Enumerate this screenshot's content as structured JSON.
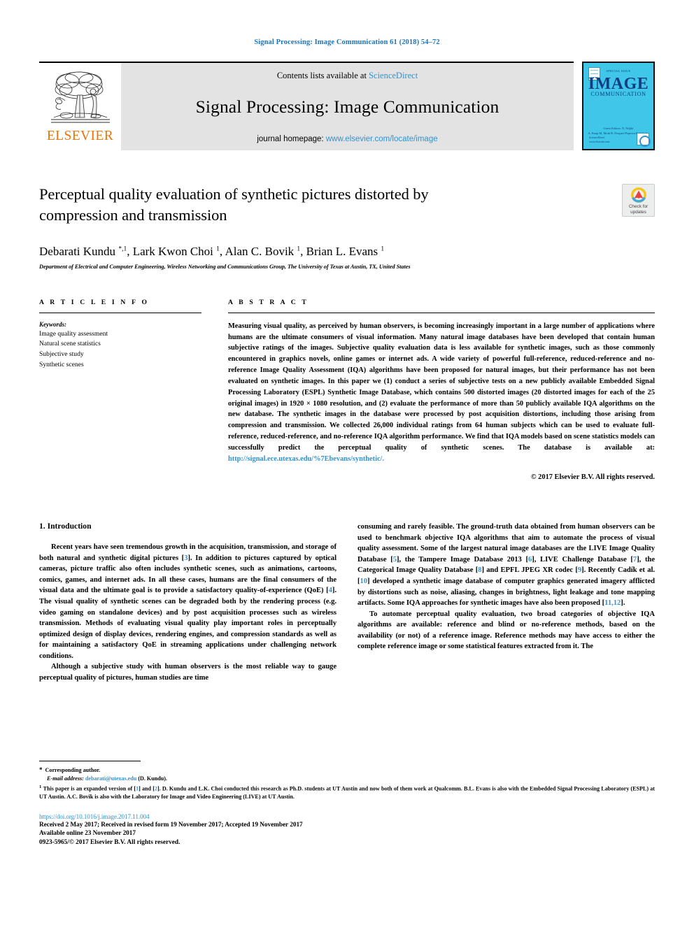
{
  "running_head": "Signal Processing: Image Communication 61 (2018) 54–72",
  "masthead": {
    "publisher_name": "ELSEVIER",
    "contents_prefix": "Contents lists available at",
    "contents_link": "ScienceDirect",
    "journal_name": "Signal Processing: Image Communication",
    "homepage_prefix": "journal homepage:",
    "homepage_link": "www.elsevier.com/locate/image",
    "cover": {
      "superline": "SPECIAL ISSUE",
      "title_line1": "IMAGE",
      "title_line2": "COMMUNICATION",
      "footer_line1": "Guest Editors: N. Ndjiki",
      "footer_line2": "A. Kaup  M. Mrak  B. Pesquet-Popescu  R. Schafer",
      "url_line1": "ScienceDirect",
      "url_line2": "www.elsevier.com"
    }
  },
  "article": {
    "title": "Perceptual quality evaluation of synthetic pictures distorted by compression and transmission",
    "authors_html": "Debarati Kundu <sup>*,1</sup>, Lark Kwon Choi <sup>1</sup>, Alan C. Bovik <sup>1</sup>, Brian L. Evans <sup>1</sup>",
    "affiliation": "Department of Electrical and Computer Engineering, Wireless Networking and Communications Group, The University of Texas at Austin, TX, United States",
    "crossmark_label_line1": "Check for",
    "crossmark_label_line2": "updates"
  },
  "article_info": {
    "heading": "A R T I C L E    I N F O",
    "keywords_label": "Keywords:",
    "keywords": [
      "Image quality assessment",
      "Natural scene statistics",
      "Subjective study",
      "Synthetic scenes"
    ]
  },
  "abstract": {
    "heading": "A B S T R A C T",
    "text_part1": "Measuring visual quality, as perceived by human observers, is becoming increasingly important in a large number of applications where humans are the ultimate consumers of visual information. Many natural image databases have been developed that contain human subjective ratings of the images. Subjective quality evaluation data is less available for synthetic images, such as those commonly encountered in graphics novels, online games or internet ads. A wide variety of powerful full-reference, reduced-reference and no-reference Image Quality Assessment (IQA) algorithms have been proposed for natural images, but their performance has not been evaluated on synthetic images. In this paper we (1) conduct a series of subjective tests on a new publicly available Embedded Signal Processing Laboratory (ESPL) Synthetic Image Database, which contains 500 distorted images (20 distorted images for each of the 25 original images) in 1920 × 1080 resolution, and (2) evaluate the performance of more than 50 publicly available IQA algorithms on the new database. The synthetic images in the database were processed by post acquisition distortions, including those arising from compression and transmission. We collected 26,000 individual ratings from 64 human subjects which can be used to evaluate full-reference, reduced-reference, and no-reference IQA algorithm performance. We find that IQA models based on scene statistics models can successfully predict the perceptual quality of synthetic scenes. The database is available at: ",
    "database_url": "http://signal.ece.utexas.edu/%7Ebevans/synthetic/.",
    "copyright": "© 2017 Elsevier B.V. All rights reserved."
  },
  "body": {
    "section_heading": "1.  Introduction",
    "left_paragraph_1_a": "Recent years have seen tremendous growth in the acquisition, transmission, and storage of both natural and synthetic digital pictures [",
    "left_paragraph_1_ref": "3",
    "left_paragraph_1_b": "]. In addition to pictures captured by optical cameras, picture traffic also often includes synthetic scenes, such as animations, cartoons, comics, games, and internet ads. In all these cases, humans are the final consumers of the visual data and the ultimate goal is to provide a satisfactory quality-of-experience (QoE) [",
    "left_paragraph_1_ref2": "4",
    "left_paragraph_1_c": "]. The visual quality of synthetic scenes can be degraded both by the rendering process (e.g. video gaming on standalone devices) and by post acquisition processes such as wireless transmission. Methods of evaluating visual quality play important roles in perceptually optimized design of display devices, rendering engines, and compression standards as well as for maintaining a satisfactory QoE in streaming applications under challenging network conditions.",
    "left_paragraph_2": "Although a subjective study with human observers is the most reliable way to gauge perceptual quality of pictures, human studies are time",
    "right_paragraph_1_a": "consuming and rarely feasible. The ground-truth data obtained from human observers can be used to benchmark objective IQA algorithms that aim to automate the process of visual quality assessment. Some of the largest natural image databases are the LIVE Image Quality Database [",
    "right_paragraph_1_r1": "5",
    "right_paragraph_1_b": "], the Tampere Image Database 2013 [",
    "right_paragraph_1_r2": "6",
    "right_paragraph_1_c": "], LIVE Challenge Database [",
    "right_paragraph_1_r3": "7",
    "right_paragraph_1_d": "], the Categorical Image Quality Database [",
    "right_paragraph_1_r4": "8",
    "right_paragraph_1_e": "] and EPFL JPEG XR codec [",
    "right_paragraph_1_r5": "9",
    "right_paragraph_1_f": "]. Recently Cadík et al. [",
    "right_paragraph_1_r6": "10",
    "right_paragraph_1_g": "] developed a synthetic image database of computer graphics generated imagery afflicted by distortions such as noise, aliasing, changes in brightness, light leakage and tone mapping artifacts. Some IQA approaches for synthetic images have also been proposed [",
    "right_paragraph_1_r7": "11,12",
    "right_paragraph_1_h": "].",
    "right_paragraph_2": "To automate perceptual quality evaluation, two broad categories of objective IQA algorithms are available: reference and blind or no-reference methods, based on the availability (or not) of a reference image. Reference methods may have access to either the complete reference image or some statistical features extracted from it. The"
  },
  "footnotes": {
    "corresponding_marker": "*",
    "corresponding_text": "Corresponding author.",
    "email_label": "E-mail address:",
    "email_value": "debarati@utexas.edu",
    "email_suffix": "(D. Kundu).",
    "note1_marker": "1",
    "note1_a": "This paper is an expanded version of [",
    "note1_r1": "1",
    "note1_b": "] and [",
    "note1_r2": "2",
    "note1_c": "]. D. Kundu and L.K. Choi conducted this research as Ph.D. students at UT Austin and now both of them work at Qualcomm. B.L. Evans is also with the Embedded Signal Processing Laboratory (ESPL) at UT Austin. A.C. Bovik is also with the Laboratory for Image and Video Engineering (LIVE) at UT Austin."
  },
  "publication": {
    "doi": "https://doi.org/10.1016/j.image.2017.11.004",
    "history": "Received 2 May 2017; Received in revised form 19 November 2017; Accepted 19 November 2017",
    "available_online": "Available online 23 November 2017",
    "issn_line": "0923-5965/© 2017 Elsevier B.V. All rights reserved."
  },
  "colors": {
    "link_blue": "#2f93d1",
    "header_blue": "#1b75bb",
    "elsevier_orange": "#ec7404",
    "cover_cyan": "#3fc6e8",
    "masthead_grey": "#e3e3e3"
  }
}
